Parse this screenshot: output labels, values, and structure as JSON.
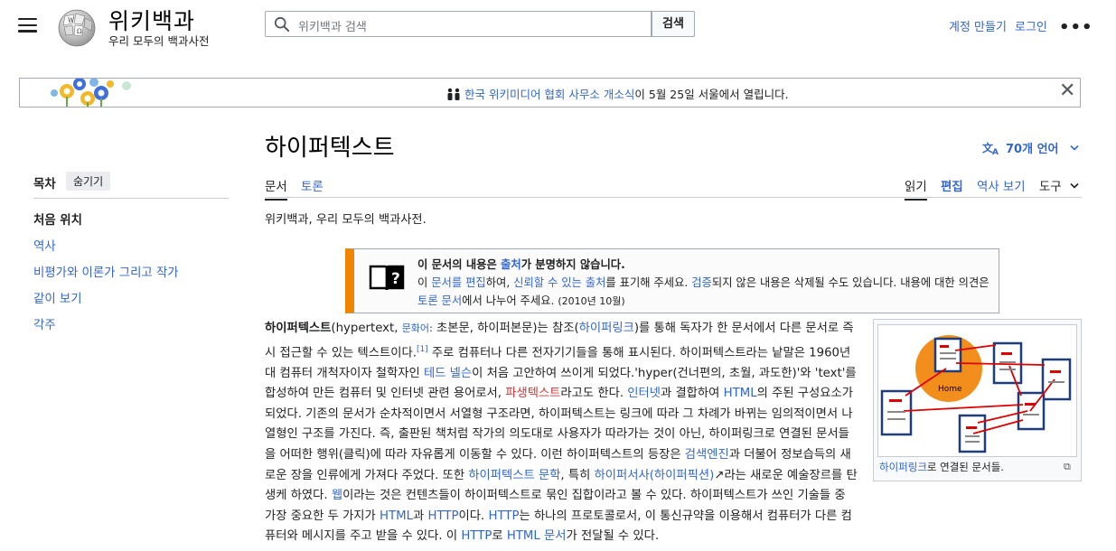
{
  "header": {
    "site_title": "위키백과",
    "site_tagline": "우리 모두의 백과사전",
    "search_placeholder": "위키백과 검색",
    "search_button": "검색",
    "create_account": "계정 만들기",
    "login": "로그인",
    "more": "•••"
  },
  "banner": {
    "link": "한국 위키미디어 협회 사무소 개소식",
    "text": "이 5월 25일 서울에서 열립니다.",
    "close": "✕"
  },
  "toc": {
    "title": "목차",
    "hide": "숨기기",
    "items": [
      "처음 위치",
      "역사",
      "비평가와 이론가 그리고 작가",
      "같이 보기",
      "각주"
    ]
  },
  "article": {
    "title": "하이퍼텍스트",
    "languages": "70개 언어",
    "tabs_left": [
      "문서",
      "토론"
    ],
    "tabs_right": [
      "읽기",
      "편집",
      "역사 보기",
      "도구"
    ],
    "from": "위키백과, 우리 모두의 백과사전."
  },
  "ambox": {
    "l1_a": "이 문서의 내용은 ",
    "l1_link": "출처",
    "l1_b": "가 분명하지 않습니다.",
    "l2_a": "이 ",
    "l2_link1": "문서를 편집",
    "l2_b": "하여, ",
    "l2_link2": "신뢰할 수 있는 출처",
    "l2_c": "를 표기해 주세요. ",
    "l2_link3": "검증",
    "l2_d": "되지 않은 내용은 삭제될 수도 있습니다. 내용에 대한 의견은 ",
    "l2_link4": "토론 문서",
    "l2_e": "에서 나누어 주세요. ",
    "date": "(2010년 10월)"
  },
  "thumb": {
    "home_label": "Home",
    "caption_link": "하이퍼링크",
    "caption_text": "로 연결된 문서들."
  },
  "colors": {
    "link": "#3366cc",
    "redlink": "#d73333",
    "ambox_stripe": "#f28500",
    "home_circle": "#f28f1c",
    "doc_border": "#1f3d7a"
  }
}
